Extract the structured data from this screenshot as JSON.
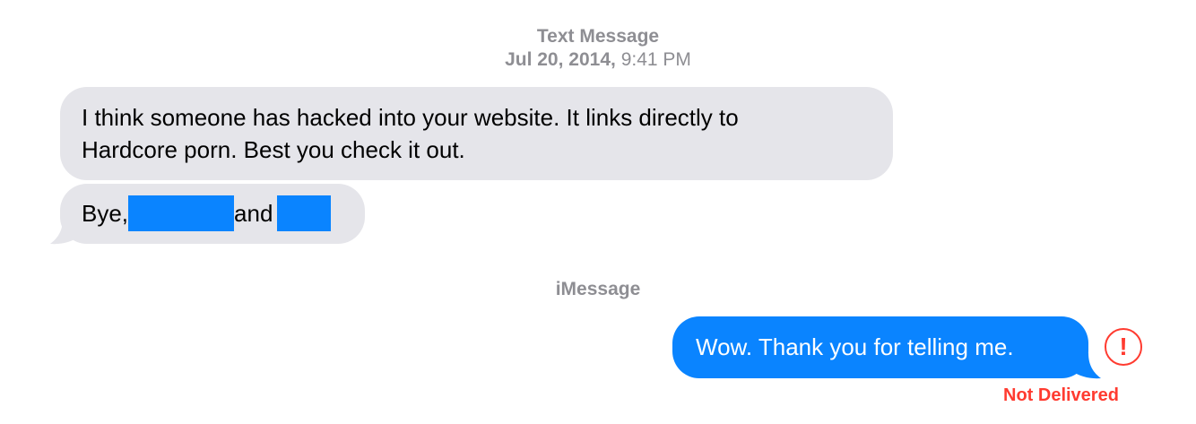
{
  "thread": {
    "service_label_1": "Text Message",
    "timestamp_date": "Jul 20, 2014,",
    "timestamp_time": "9:41 PM",
    "service_label_2": "iMessage"
  },
  "messages": [
    {
      "direction": "incoming",
      "lines": [
        "I think someone has hacked into your website. It links directly to",
        "Hardcore porn. Best you check it out."
      ]
    },
    {
      "direction": "incoming",
      "prefix": "Bye,",
      "middle": "and",
      "redacted": true
    },
    {
      "direction": "outgoing",
      "text": "Wow. Thank you for telling me.",
      "status": "Not Delivered",
      "error_icon": "exclamation-circle-icon"
    }
  ],
  "colors": {
    "incoming_bubble": "#e5e5ea",
    "outgoing_bubble": "#0a84ff",
    "error": "#ff3b30",
    "meta_text": "#8e8e93"
  }
}
